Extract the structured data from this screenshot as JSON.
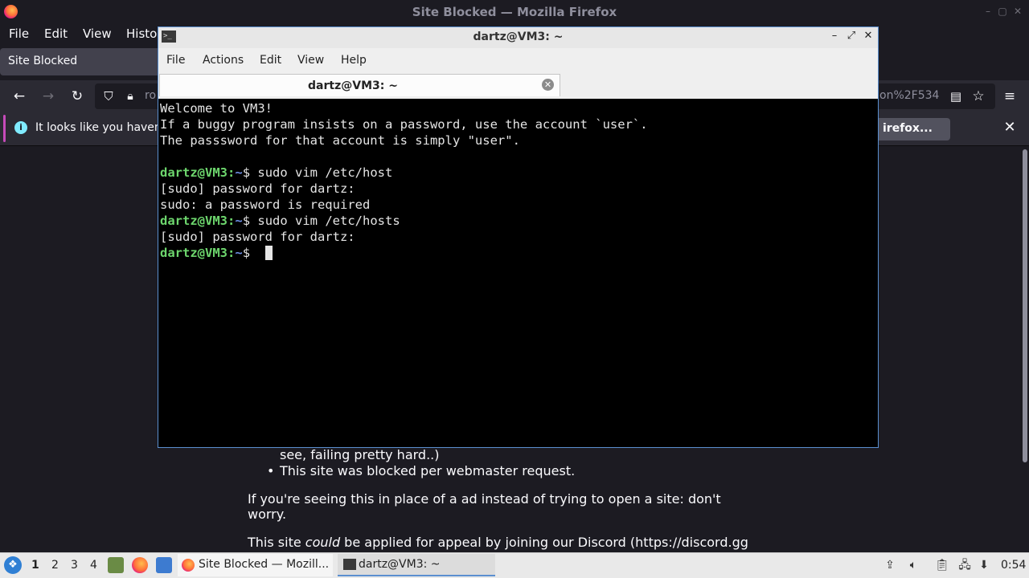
{
  "firefox": {
    "window_title": "Site Blocked — Mozilla Firefox",
    "menu": [
      "File",
      "Edit",
      "View",
      "Histor"
    ],
    "tab_title": "Site Blocked",
    "url_left": "ro",
    "url_right": "on%2F534",
    "notification": {
      "text": "It looks like you haven",
      "button": "irefox...",
      "info_glyph": "i",
      "close_glyph": "✕"
    },
    "page": {
      "bullet_fragment": "see, failing pretty hard..)",
      "bullet_item": "This site was blocked per webmaster request.",
      "paragraph1_line1": "If you're seeing this in place of a ad instead of trying to open a site: don't",
      "paragraph1_line2": "worry.",
      "paragraph2_pre": "This site ",
      "paragraph2_em": "could",
      "paragraph2_post": " be applied for appeal by joining our Discord (https://discord.gg"
    }
  },
  "terminal": {
    "window_title": "dartz@VM3: ~",
    "menu": [
      "File",
      "Actions",
      "Edit",
      "View",
      "Help"
    ],
    "tab_title": "dartz@VM3: ~",
    "lines": [
      "Welcome to VM3!",
      "If a buggy program insists on a password, use the account `user`.",
      "The passsword for that account is simply \"user\"."
    ],
    "prompt_user": "dartz@VM3",
    "prompt_colon": ":",
    "prompt_path": "~",
    "prompt_symbol": "$ ",
    "cmd1": "sudo vim /etc/host",
    "sudo_prompt": "[sudo] password for dartz:",
    "sudo_error": "sudo: a password is required",
    "cmd2": "sudo vim /etc/hosts"
  },
  "taskbar": {
    "workspaces": [
      "1",
      "2",
      "3",
      "4"
    ],
    "task_firefox": "Site Blocked — Mozill...",
    "task_terminal": "dartz@VM3: ~",
    "clock": "0:54",
    "colors": {
      "accent": "#2f7fd4",
      "active_underline": "#5b8fd0"
    }
  }
}
